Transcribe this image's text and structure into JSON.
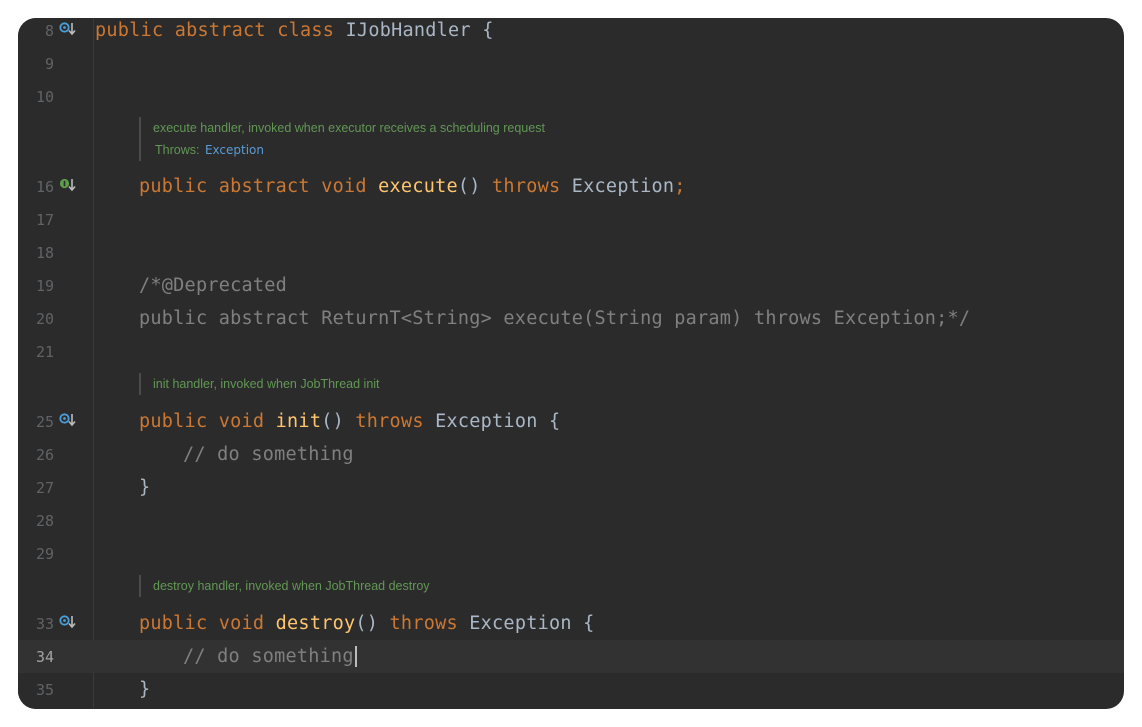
{
  "editor": {
    "lines": [
      {
        "num": "8",
        "code": "public abstract class IJobHandler {"
      },
      {
        "num": "9"
      },
      {
        "num": "10"
      },
      {
        "num": "16",
        "code": "public abstract void execute() throws Exception;"
      },
      {
        "num": "17"
      },
      {
        "num": "18"
      },
      {
        "num": "19",
        "code": "/*@Deprecated"
      },
      {
        "num": "20",
        "code": "public abstract ReturnT<String> execute(String param) throws Exception;*/"
      },
      {
        "num": "21"
      },
      {
        "num": "25",
        "code": "public void init() throws Exception {"
      },
      {
        "num": "26",
        "code": "// do something"
      },
      {
        "num": "27",
        "code": "}"
      },
      {
        "num": "28"
      },
      {
        "num": "29"
      },
      {
        "num": "33",
        "code": "public void destroy() throws Exception {"
      },
      {
        "num": "34",
        "code": "// do something"
      },
      {
        "num": "35",
        "code": "}"
      }
    ],
    "docs": {
      "execute": {
        "text": "execute handler, invoked when executor receives a scheduling request",
        "throws_label": "Throws:",
        "throws_value": "Exception"
      },
      "init": {
        "text": "init handler, invoked when JobThread init"
      },
      "destroy": {
        "text": "destroy handler, invoked when JobThread destroy"
      }
    },
    "gutter_icons": {
      "l8": "overridden-down-icon",
      "l16": "implemented-down-icon",
      "l25": "overridden-down-icon",
      "l33": "overridden-down-icon"
    }
  }
}
